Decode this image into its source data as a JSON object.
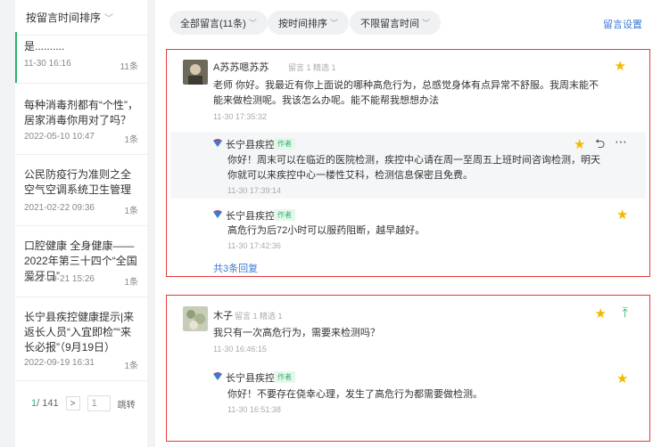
{
  "sidebar": {
    "sort_label": "按留言时间排序",
    "articles": [
      {
        "title": "是..........",
        "date": "11-30 16:16",
        "count": "11条"
      },
      {
        "title": "每种消毒剂都有“个性”，居家消毒你用对了吗？",
        "date": "2022-05-10 10:47",
        "count": "1条"
      },
      {
        "title": "公民防疫行为准则之全空气空调系统卫生管理",
        "date": "2021-02-22 09:36",
        "count": "1条"
      },
      {
        "title": "口腔健康 全身健康——2022年第三十四个“全国爱牙日”",
        "date": "2022-09-21 15:26",
        "count": "1条"
      },
      {
        "title": "长宁县疾控健康提示|来返长人员“入宜即检”“来长必报”（9月19日）",
        "date": "2022-09-19 16:31",
        "count": "1条"
      }
    ],
    "pager": {
      "current": "1",
      "total": " / 141",
      "next": ">",
      "input_value": "1",
      "jump": "跳转"
    }
  },
  "toolbar": {
    "filter_all": "全部留言(11条)",
    "sort_time": "按时间排序",
    "time_range": "不限留言时间",
    "settings": "留言设置"
  },
  "comments": [
    {
      "nickname": "A苏苏嗯苏苏",
      "meta": "留言 1  精选 1",
      "text": "老师 你好。我最近有你上面说的哪种高危行为，总感觉身体有点异常不舒服。我周末能不能来做检测呢。我该怎么办呢。能不能帮我想想办法",
      "time": "11-30 17:35:32",
      "replies": [
        {
          "author": "长宁县疾控",
          "badge": "作者",
          "text": "你好！周末可以在临近的医院检测，疾控中心请在周一至周五上班时间咨询检测，明天你就可以来疾控中心一楼性艾科，检测信息保密且免费。",
          "time": "11-30 17:39:14"
        },
        {
          "author": "长宁县疾控",
          "badge": "作者",
          "text": "高危行为后72小时可以服药阻断，越早越好。",
          "time": "11-30 17:42:36"
        }
      ],
      "more": "共3条回复"
    },
    {
      "nickname": "木子",
      "meta": "留言 1  精选 1",
      "text": "我只有一次高危行为，需要来检测吗？",
      "time": "11-30 16:46:15",
      "replies": [
        {
          "author": "长宁县疾控",
          "badge": "作者",
          "text": "你好！不要存在侥幸心理，发生了高危行为都需要做检测。",
          "time": "11-30 16:51:38"
        }
      ]
    }
  ],
  "colors": {
    "accent": "#2db36a",
    "link": "#3a7bd5",
    "highlight_border": "#e53935",
    "star": "#f5b800"
  },
  "icons": [
    "chevron-down-icon",
    "star-icon",
    "reply-icon",
    "more-icon",
    "pin-top-icon",
    "cdc-logo-icon"
  ]
}
